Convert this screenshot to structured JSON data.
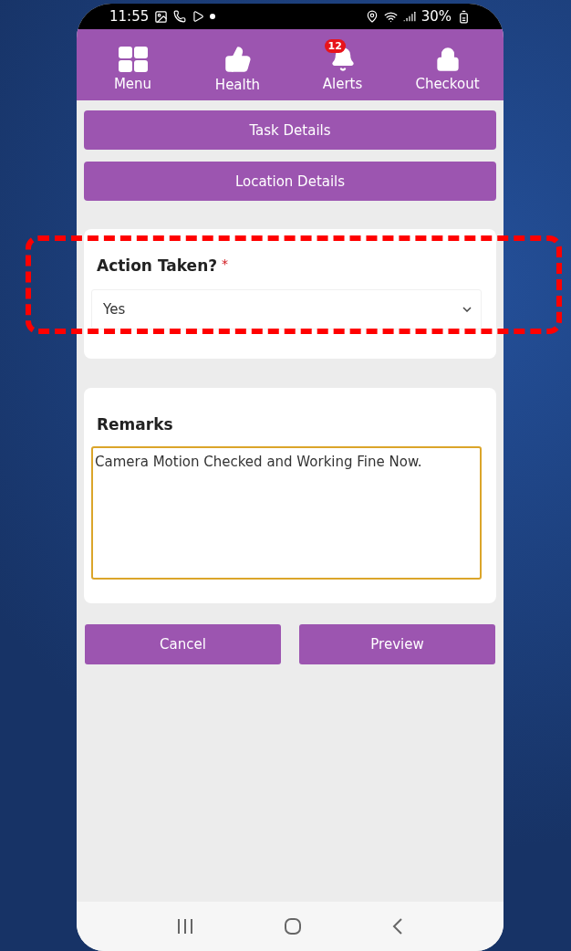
{
  "status_bar": {
    "time": "11:55",
    "battery": "30%"
  },
  "nav_items": [
    {
      "kind": "grid",
      "label": "Menu"
    },
    {
      "kind": "thumb",
      "label": "Health"
    },
    {
      "kind": "bell",
      "label": "Alerts",
      "badge": "12"
    },
    {
      "kind": "lock",
      "label": "Checkout"
    }
  ],
  "sections": [
    {
      "label": "Task Details"
    },
    {
      "label": "Location Details"
    }
  ],
  "action_field": {
    "label": "Action Taken?",
    "required_mark": "*",
    "value": "Yes"
  },
  "remarks": {
    "label": "Remarks",
    "value": "Camera Motion Checked and Working Fine Now.",
    "focused": true
  },
  "buttons": [
    {
      "label": "Cancel"
    },
    {
      "label": "Preview"
    }
  ]
}
